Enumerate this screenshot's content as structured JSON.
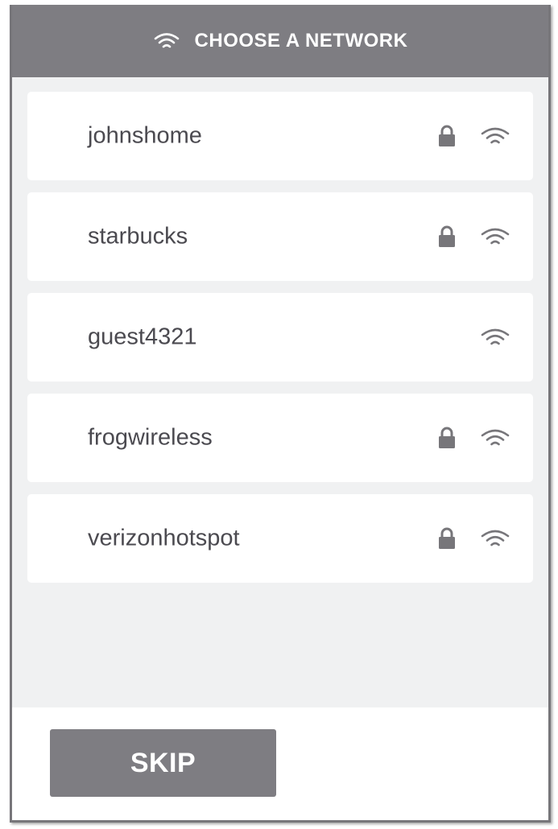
{
  "header": {
    "title": "CHOOSE A NETWORK",
    "icon": "wifi-icon"
  },
  "networks": [
    {
      "name": "johnshome",
      "secured": true
    },
    {
      "name": "starbucks",
      "secured": true
    },
    {
      "name": "guest4321",
      "secured": false
    },
    {
      "name": "frogwireless",
      "secured": true
    },
    {
      "name": "verizonhotspot",
      "secured": true
    }
  ],
  "footer": {
    "skip_label": "SKIP"
  },
  "colors": {
    "header_bg": "#7e7d82",
    "panel_bg": "#f0f1f2",
    "text": "#4b4a50",
    "icon": "#77767a"
  }
}
